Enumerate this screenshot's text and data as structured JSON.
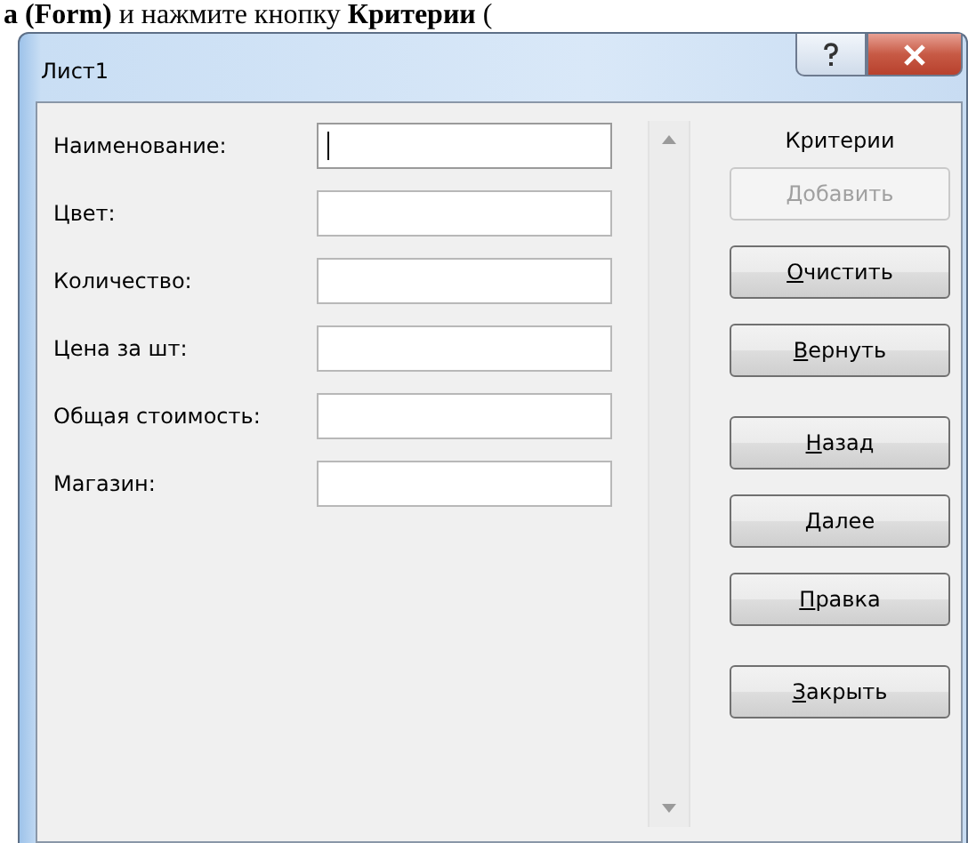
{
  "document_text": "**а (Form)** и нажмите кнопку **Критерии** (",
  "window": {
    "title": "Лист1"
  },
  "fields": [
    {
      "label": "Наименование:",
      "focused": true
    },
    {
      "label": "Цвет:",
      "focused": false
    },
    {
      "label": "Количество:",
      "focused": false
    },
    {
      "label": "Цена за шт:",
      "focused": false
    },
    {
      "label": "Общая стоимость:",
      "focused": false
    },
    {
      "label": "Магазин:",
      "focused": false
    }
  ],
  "mode_label": "Критерии",
  "button_groups": [
    [
      {
        "label": "Добавить",
        "disabled": true
      },
      {
        "label": "Очистить",
        "disabled": false
      },
      {
        "label": "Вернуть",
        "disabled": false
      }
    ],
    [
      {
        "label": "Назад",
        "disabled": false
      },
      {
        "label": "Далее",
        "disabled": false
      },
      {
        "label": "Правка",
        "disabled": false
      }
    ],
    [
      {
        "label": "Закрыть",
        "disabled": false
      }
    ]
  ]
}
